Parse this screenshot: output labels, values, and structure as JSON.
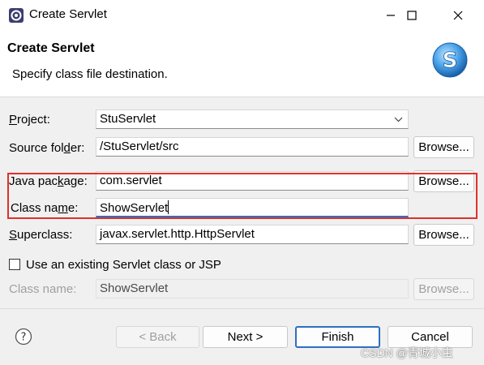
{
  "window": {
    "title": "Create Servlet",
    "controls": [
      "minimize",
      "maximize",
      "close"
    ]
  },
  "header": {
    "title": "Create Servlet",
    "description": "Specify class file destination."
  },
  "form": {
    "project": {
      "label": "Project:",
      "mnemonic": "P",
      "value": "StuServlet"
    },
    "source_folder": {
      "label": "Source folder:",
      "mnemonic": "d",
      "value": "/StuServlet/src",
      "browse": "Browse..."
    },
    "java_package": {
      "label": "Java package:",
      "mnemonic": "k",
      "value": "com.servlet",
      "browse": "Browse..."
    },
    "class_name": {
      "label": "Class name:",
      "mnemonic": "m",
      "value": "ShowServlet"
    },
    "superclass": {
      "label": "Superclass:",
      "mnemonic": "S",
      "value": "javax.servlet.http.HttpServlet",
      "browse": "Browse..."
    },
    "use_existing": {
      "label": "Use an existing Servlet class or JSP",
      "checked": false
    },
    "existing_class_name": {
      "label": "Class name:",
      "value": "ShowServlet",
      "browse": "Browse..."
    }
  },
  "footer": {
    "back": "< Back",
    "next": "Next >",
    "finish": "Finish",
    "cancel": "Cancel"
  },
  "watermark": "CSDN @青城小虫",
  "colors": {
    "highlight": "#e0302c",
    "focus": "#2f6fbf"
  }
}
